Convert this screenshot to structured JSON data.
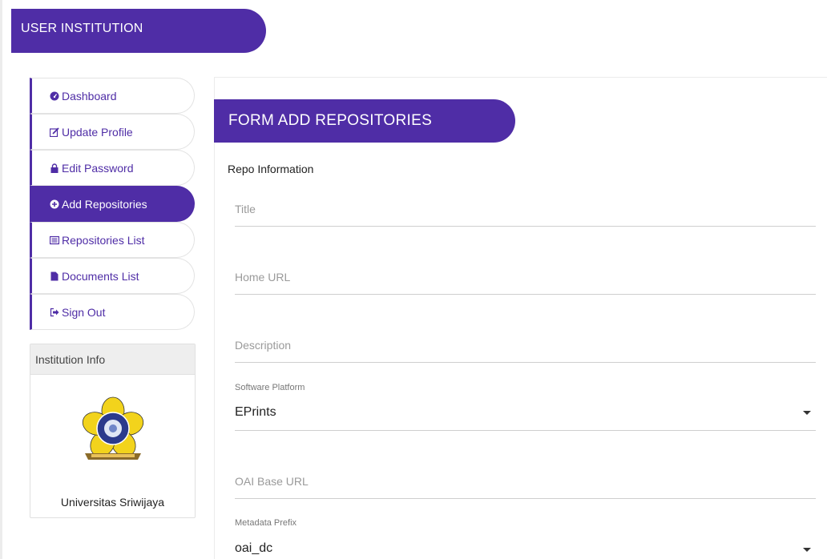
{
  "header": {
    "title": "USER INSTITUTION"
  },
  "menu": {
    "items": [
      {
        "label": "Dashboard",
        "icon": "dashboard-icon",
        "active": false
      },
      {
        "label": "Update Profile",
        "icon": "edit-icon",
        "active": false
      },
      {
        "label": "Edit Password",
        "icon": "lock-icon",
        "active": false
      },
      {
        "label": "Add Repositories",
        "icon": "plus-circle-icon",
        "active": true
      },
      {
        "label": "Repositories List",
        "icon": "list-icon",
        "active": false
      },
      {
        "label": "Documents List",
        "icon": "file-icon",
        "active": false
      },
      {
        "label": "Sign Out",
        "icon": "sign-out-icon",
        "active": false
      }
    ]
  },
  "institution_panel": {
    "heading": "Institution Info",
    "name": "Universitas Sriwijaya",
    "logo": "university-emblem"
  },
  "form": {
    "title": "FORM ADD REPOSITORIES",
    "section": "Repo Information",
    "title_placeholder": "Title",
    "home_url_placeholder": "Home URL",
    "description_placeholder": "Description",
    "software_platform_label": "Software Platform",
    "software_platform_value": "EPrints",
    "oai_base_url_placeholder": "OAI Base URL",
    "metadata_prefix_label": "Metadata Prefix",
    "metadata_prefix_value": "oai_dc"
  },
  "colors": {
    "accent": "#4f2da6",
    "logo_yellow": "#f2d31c",
    "logo_blue": "#2b3a8c"
  }
}
